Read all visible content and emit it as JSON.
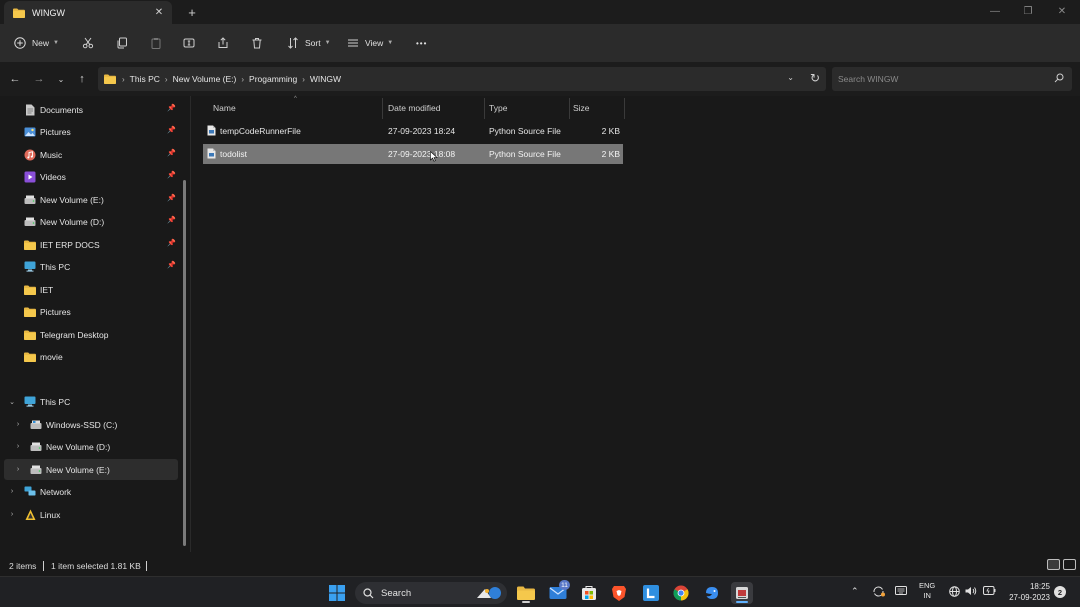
{
  "window": {
    "tab_title": "WINGW",
    "tab_close": "✕",
    "new_tab": "+",
    "minimize": "—",
    "maximize": "❐",
    "close": "✕"
  },
  "toolbar": {
    "new_label": "New",
    "sort_label": "Sort",
    "view_label": "View",
    "more": "•••"
  },
  "address": {
    "crumbs": [
      "This PC",
      "New Volume (E:)",
      "Progamming",
      "WINGW"
    ],
    "search_placeholder": "Search WINGW"
  },
  "sidebar": {
    "quick_access": [
      {
        "label": "Documents",
        "icon": "documents-icon",
        "pinned": true
      },
      {
        "label": "Pictures",
        "icon": "pictures-icon",
        "pinned": true
      },
      {
        "label": "Music",
        "icon": "music-icon",
        "pinned": true
      },
      {
        "label": "Videos",
        "icon": "videos-icon",
        "pinned": true
      },
      {
        "label": "New Volume (E:)",
        "icon": "drive-icon",
        "pinned": true
      },
      {
        "label": "New Volume (D:)",
        "icon": "drive-icon",
        "pinned": true
      },
      {
        "label": "IET ERP DOCS",
        "icon": "folder-icon",
        "pinned": true
      },
      {
        "label": "This PC",
        "icon": "this-pc-icon",
        "pinned": true
      },
      {
        "label": "IET",
        "icon": "folder-icon",
        "pinned": false
      },
      {
        "label": "Pictures",
        "icon": "folder-icon",
        "pinned": false
      },
      {
        "label": "Telegram Desktop",
        "icon": "folder-icon",
        "pinned": false
      },
      {
        "label": "movie",
        "icon": "folder-icon",
        "pinned": false
      }
    ],
    "this_pc": {
      "label": "This PC",
      "children": [
        {
          "label": "Windows-SSD (C:)"
        },
        {
          "label": "New Volume (D:)"
        },
        {
          "label": "New Volume (E:)",
          "selected": true
        }
      ]
    },
    "network": "Network",
    "linux": "Linux"
  },
  "columns": {
    "name": "Name",
    "date": "Date modified",
    "type": "Type",
    "size": "Size"
  },
  "files": [
    {
      "name": "tempCodeRunnerFile",
      "date": "27-09-2023 18:24",
      "type": "Python Source File",
      "size": "2 KB",
      "selected": false
    },
    {
      "name": "todolist",
      "date": "27-09-2023 18:08",
      "type": "Python Source File",
      "size": "2 KB",
      "selected": true
    }
  ],
  "status": {
    "items": "2 items",
    "selected": "1 item selected  1.81 KB"
  },
  "taskbar": {
    "search_label": "Search",
    "mail_badge": "11",
    "lang_line1": "ENG",
    "lang_line2": "IN",
    "time": "18:25",
    "date": "27-09-2023",
    "notifications": "2"
  }
}
